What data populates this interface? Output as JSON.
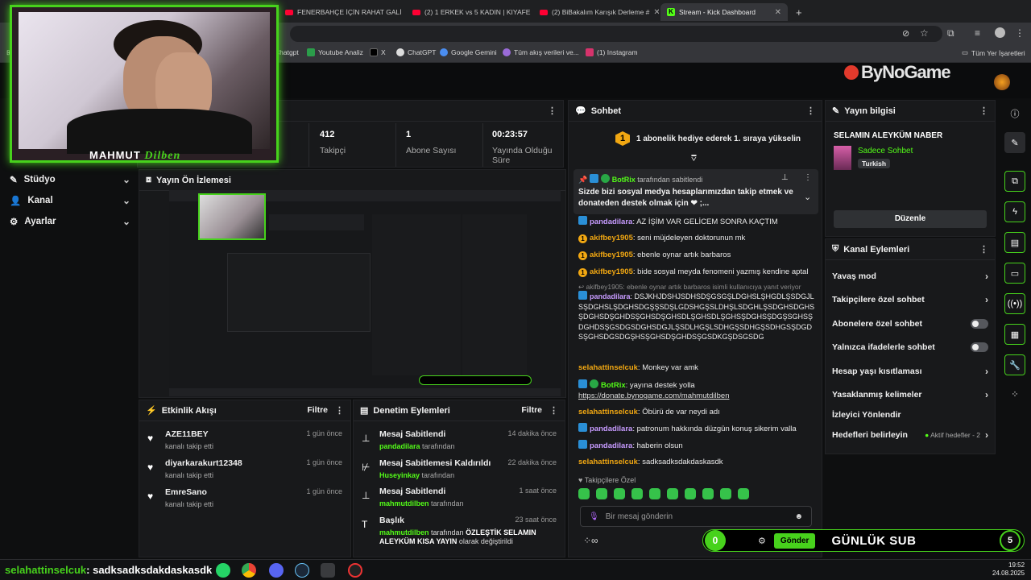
{
  "browser": {
    "tabs": [
      {
        "label": "FENERBAHÇE İÇİN RAHAT GALİ",
        "active": false
      },
      {
        "label": "(2) 1 ERKEK vs 5 KADIN | KIYAFE",
        "active": false
      },
      {
        "label": "(2) BiBakalım Karışık Derleme #",
        "active": false
      },
      {
        "label": "Stream - Kick Dashboard",
        "active": true
      }
    ],
    "new_tab": "+",
    "bookmarks": [
      "Chatgpt",
      "Youtube Analiz",
      "X",
      "ChatGPT",
      "Google Gemini",
      "Tüm akış verileri ve...",
      "(1) Instagram"
    ],
    "all_bookmarks": "Tüm Yer İşaretleri"
  },
  "brand": {
    "logo": "ByNoGame"
  },
  "webcam": {
    "name_first": "MAHMUT",
    "name_second": "Dilben"
  },
  "sidebar": {
    "items": [
      {
        "label": "Stüdyo"
      },
      {
        "label": "Kanal"
      },
      {
        "label": "Ayarlar"
      }
    ]
  },
  "stats": {
    "items": [
      {
        "value": "412",
        "label": "Takipçi"
      },
      {
        "value": "1",
        "label": "Abone Sayısı"
      },
      {
        "value": "00:23:57",
        "label": "Yayında Olduğu Süre"
      }
    ]
  },
  "preview": {
    "title": "Yayın Ön İzlemesi"
  },
  "activity": {
    "title": "Etkinlik Akışı",
    "filter": "Filtre",
    "items": [
      {
        "user": "AZE11BEY",
        "text": "kanalı takip etti",
        "time": "1 gün önce"
      },
      {
        "user": "diyarkarakurt12348",
        "text": "kanalı takip etti",
        "time": "1 gün önce"
      },
      {
        "user": "EmreSano",
        "text": "kanalı takip etti",
        "time": "1 gün önce"
      }
    ]
  },
  "moderation": {
    "title": "Denetim Eylemleri",
    "filter": "Filtre",
    "items": [
      {
        "title": "Mesaj Sabitlendi",
        "user": "pandadilara",
        "text": "tarafından",
        "time": "14 dakika önce"
      },
      {
        "title": "Mesaj Sabitlemesi Kaldırıldı",
        "user": "Huseyinkay",
        "text": "tarafından",
        "time": "22 dakika önce"
      },
      {
        "title": "Mesaj Sabitlendi",
        "user": "mahmutdilben",
        "text": "tarafından",
        "time": "1 saat önce"
      },
      {
        "title": "Başlık",
        "user": "mahmutdilben",
        "text": "tarafından",
        "highlight": "ÖZLEŞTİK SELAMIN ALEYKÜM KISA YAYIN",
        "suffix": "olarak değiştirildi",
        "time": "23 saat önce"
      }
    ]
  },
  "chat": {
    "title": "Sohbet",
    "banner_badge": "1",
    "banner": "1 abonelik hediye ederek 1. sıraya yükselin",
    "pinned": {
      "user": "BotRix",
      "by": "tarafından sabitlendi",
      "text": "Sizde bizi sosyal medya hesaplarımızdan takip etmek ve donateden destek olmak için ❤ ;..."
    },
    "messages": [
      {
        "user": "pandadilara",
        "text": ": AZ İŞİM VAR GELİCEM SONRA KAÇTIM",
        "color": "#c79bff"
      },
      {
        "user": "akifbey1905",
        "text": ": seni müjdeleyen doktorunun mk",
        "color": "#f1a712"
      },
      {
        "user": "akifbey1905",
        "text": ": ebenle oynar artık barbaros",
        "color": "#f1a712"
      },
      {
        "user": "akifbey1905",
        "text": ": bide sosyal meyda fenomeni yazmış kendine aptal",
        "color": "#f1a712"
      },
      {
        "user": "pandadilara",
        "text": ": DSJKHJDSHJSDHSDŞGSGŞLDGHSLŞHGDLŞSDGJLSŞDGHSLŞDGHSDGŞŞSDŞLGDSHGŞSLDHŞLSDGHLŞSDGHSDGHSŞDGHSDŞGHDSŞGHSDŞGHSDLŞGHSDLŞGHSŞDGHSŞDGŞSGHSŞDGHDSŞGSDGSDGHSDGJLŞSDLHGŞLSDHGŞSDHGŞSDHGSŞDGDSŞGHSDGSDGŞHSŞGHSDŞGHDSŞGSDKGŞDSGSDG",
        "color": "#c79bff"
      },
      {
        "user": "selahattinselcuk",
        "text": ": Monkey var amk",
        "color": "#f1a712"
      },
      {
        "user": "BotRix",
        "text": ": yayına destek yolla",
        "link": "https://donate.bynogame.com/mahmutdilben",
        "color": "#53fc18"
      },
      {
        "user": "selahattinselcuk",
        "text": ": Öbürü de var neydi adı",
        "color": "#f1a712"
      },
      {
        "user": "pandadilara",
        "text": ": patronum hakkında düzgün konuş sikerim valla",
        "color": "#c79bff"
      },
      {
        "user": "pandadilara",
        "text": ": haberin olsun",
        "color": "#c79bff"
      },
      {
        "user": "selahattinselcuk",
        "text": ": sadksadksdakdaskasdk",
        "color": "#f1a712"
      }
    ],
    "reply_note": "akifbey1905: ebenle oynar artık barbaros isimli kullanıcıya yanıt veriyor",
    "followers_only": "Takipçilere Özel",
    "input_placeholder": "Bir mesaj gönderin",
    "send": "Gönder",
    "counter": "0"
  },
  "stream_info": {
    "title": "Yayın bilgisi",
    "stream_title": "SELAMIN ALEYKÜM NABER",
    "category": "Sadece Sohbet",
    "language": "Turkish",
    "edit": "Düzenle"
  },
  "channel_actions": {
    "title": "Kanal Eylemleri",
    "items": [
      {
        "label": "Yavaş mod",
        "kind": "chevron"
      },
      {
        "label": "Takipçilere özel sohbet",
        "kind": "chevron"
      },
      {
        "label": "Abonelere özel sohbet",
        "kind": "toggle"
      },
      {
        "label": "Yalnızca ifadelerle sohbet",
        "kind": "toggle"
      },
      {
        "label": "Hesap yaşı kısıtlaması",
        "kind": "chevron"
      },
      {
        "label": "Yasaklanmış kelimeler",
        "kind": "chevron"
      },
      {
        "label": "İzleyici Yönlendir",
        "kind": "none"
      },
      {
        "label": "Hedefleri belirleyin",
        "kind": "goal",
        "extra": "Aktif hedefler - 2"
      }
    ]
  },
  "overlay": {
    "sub_label": "GÜNLÜK SUB",
    "sub_count": "5",
    "last_user": "selahattinselcuk",
    "last_msg": ": sadksadksdakdaskasdk"
  },
  "taskbar": {
    "time": "19:52",
    "date": "24.08.2025"
  },
  "colors": {
    "accent": "#53fc18",
    "panel": "#18191b",
    "bg": "#0e0f10"
  }
}
